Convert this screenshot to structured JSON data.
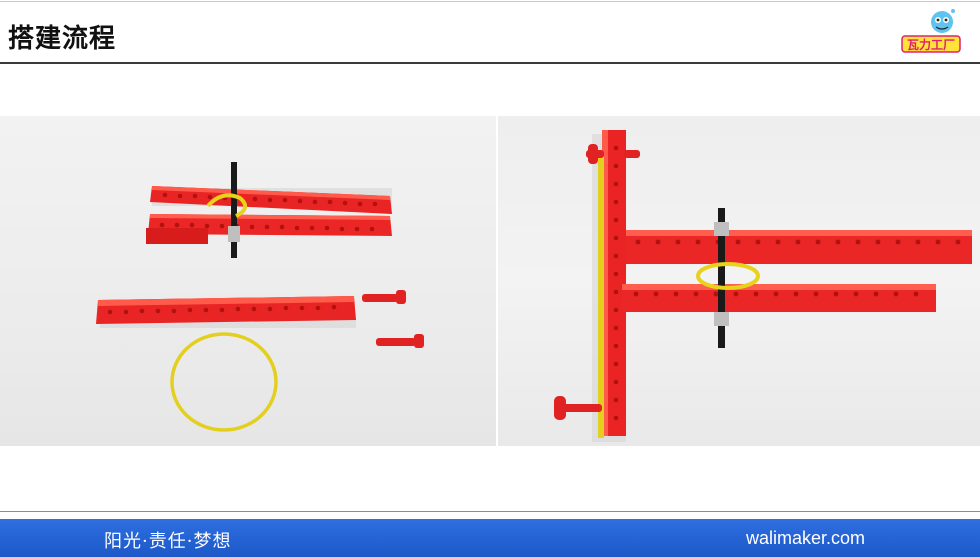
{
  "header": {
    "title": "搭建流程",
    "logo_text": "瓦力工厂"
  },
  "footer": {
    "slogan": "阳光·责任·梦想",
    "website": "walimaker.com"
  },
  "colors": {
    "brick_red": "#f02a2a",
    "footer_blue": "#1f5fd0",
    "rubber_band": "#e8d21c",
    "axle_black": "#1a1a1a"
  }
}
